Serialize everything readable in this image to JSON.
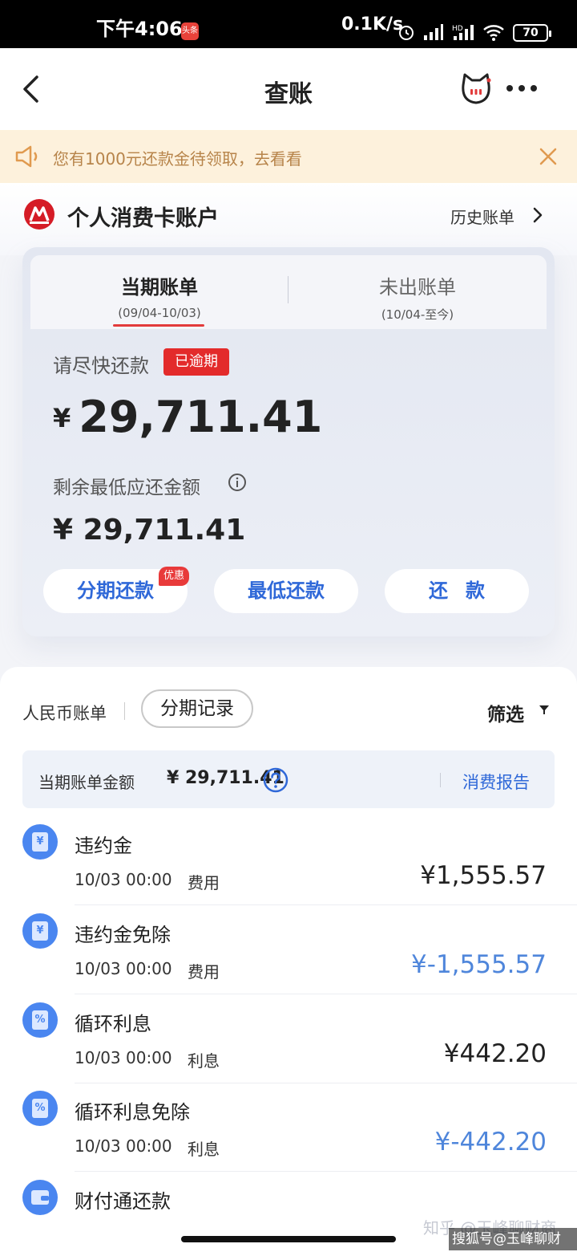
{
  "status_bar": {
    "time": "下午4:06",
    "badge": "头条",
    "speed": "0.1K/s",
    "battery": "70"
  },
  "header": {
    "title": "查账"
  },
  "notice": {
    "text": "您有1000元还款金待领取，去看看"
  },
  "account": {
    "title": "个人消费卡账户",
    "history_label": "历史账单"
  },
  "bill_card": {
    "tabs": [
      {
        "label": "当期账单",
        "range": "(09/04-10/03)"
      },
      {
        "label": "未出账单",
        "range": "(10/04-至今)"
      }
    ],
    "repay_label": "请尽快还款",
    "status_badge": "已逾期",
    "currency": "¥",
    "total_amount": "29,711.41",
    "min_label": "剩余最低应还金额",
    "min_amount": "¥ 29,711.41",
    "buttons": {
      "installment": "分期还款",
      "minimum": "最低还款",
      "repay": "还款",
      "promo_badge": "优惠"
    }
  },
  "list": {
    "currency_label": "人民币账单",
    "installment_chip": "分期记录",
    "filter_label": "筛选",
    "summary_label": "当期账单金额",
    "summary_amount": "¥ 29,711.41",
    "report_link": "消费报告",
    "transactions": [
      {
        "title": "违约金",
        "time": "10/03 00:00",
        "type": "费用",
        "amount": "¥1,555.57",
        "icon": "yen-icon"
      },
      {
        "title": "违约金免除",
        "time": "10/03 00:00",
        "type": "费用",
        "amount": "¥-1,555.57",
        "icon": "yen-icon"
      },
      {
        "title": "循环利息",
        "time": "10/03 00:00",
        "type": "利息",
        "amount": "¥442.20",
        "icon": "percent-icon"
      },
      {
        "title": "循环利息免除",
        "time": "10/03 00:00",
        "type": "利息",
        "amount": "¥-442.20",
        "icon": "percent-icon"
      },
      {
        "title": "财付通还款",
        "icon": "wallet-icon"
      }
    ]
  },
  "watermark": {
    "text": "知乎 @玉峰聊财商",
    "tag": "搜狐号@玉峰聊财商"
  },
  "colors": {
    "accent_blue": "#2f68d8",
    "overdue_red": "#e32b2b",
    "notice_bg": "#fdf1dc",
    "credit_blue": "#4f86db"
  }
}
